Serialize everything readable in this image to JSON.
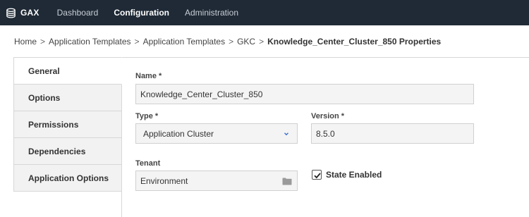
{
  "app": {
    "name": "GAX",
    "logo_icon": "database-stack-icon"
  },
  "nav": {
    "items": [
      {
        "label": "Dashboard",
        "active": false
      },
      {
        "label": "Configuration",
        "active": true
      },
      {
        "label": "Administration",
        "active": false
      }
    ]
  },
  "breadcrumb": {
    "items": [
      "Home",
      "Application Templates",
      "Application Templates",
      "GKC"
    ],
    "current": "Knowledge_Center_Cluster_850 Properties",
    "separator": ">"
  },
  "tabs": [
    {
      "label": "General",
      "active": true
    },
    {
      "label": "Options",
      "active": false
    },
    {
      "label": "Permissions",
      "active": false
    },
    {
      "label": "Dependencies",
      "active": false
    },
    {
      "label": "Application Options",
      "active": false
    }
  ],
  "form": {
    "name": {
      "label": "Name *",
      "value": "Knowledge_Center_Cluster_850"
    },
    "type": {
      "label": "Type *",
      "value": "Application Cluster"
    },
    "version": {
      "label": "Version *",
      "value": "8.5.0"
    },
    "tenant": {
      "label": "Tenant",
      "value": "Environment"
    },
    "state_enabled": {
      "label": "State Enabled",
      "checked": true
    }
  },
  "colors": {
    "topbar": "#1f2a36",
    "field_bg": "#f4f4f4",
    "tab_bg": "#f2f2f2"
  }
}
